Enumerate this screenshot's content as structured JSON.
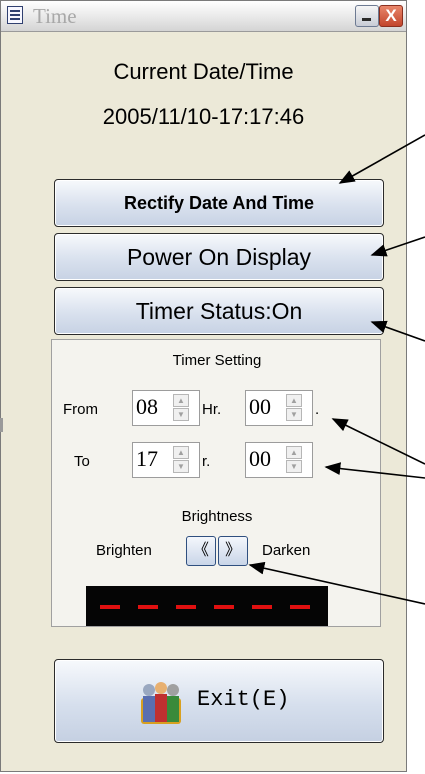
{
  "window": {
    "title": "Time",
    "close_glyph": "X"
  },
  "current": {
    "label": "Current Date/Time",
    "value": "2005/11/10-17:17:46"
  },
  "buttons": {
    "rectify": "Rectify Date And Time",
    "power_on_display": "Power On Display",
    "timer_status": "Timer Status:On"
  },
  "timer": {
    "title": "Timer Setting",
    "from_label": "From",
    "to_label": "To",
    "from_hour": "08",
    "from_hour_unit": "Hr.",
    "from_minute": "00",
    "from_minute_unit": ".",
    "to_hour": "17",
    "to_hour_unit": "r.",
    "to_minute": "00"
  },
  "brightness": {
    "title": "Brightness",
    "brighten_label": "Brighten",
    "darken_label": "Darken",
    "left_glyph": "《",
    "right_glyph": "》",
    "led_color": "#e01010"
  },
  "exit": {
    "label": "Exit(E)",
    "icon": "users-group-icon"
  }
}
